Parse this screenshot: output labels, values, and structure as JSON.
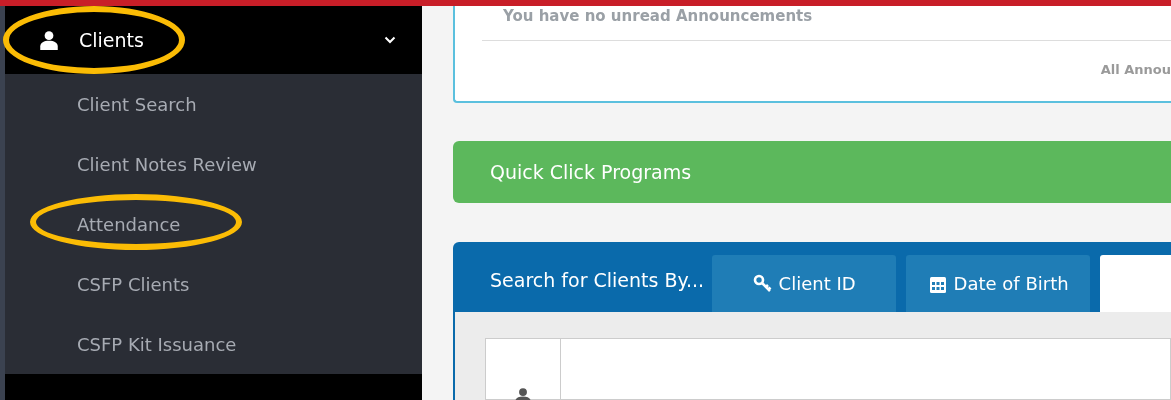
{
  "sidebar": {
    "section": {
      "label": "Clients",
      "expanded": true,
      "highlighted": true
    },
    "items": [
      {
        "label": "Client Search",
        "highlighted": false
      },
      {
        "label": "Client Notes Review",
        "highlighted": false
      },
      {
        "label": "Attendance",
        "highlighted": true
      },
      {
        "label": "CSFP Clients",
        "highlighted": false
      },
      {
        "label": "CSFP Kit Issuance",
        "highlighted": false
      }
    ]
  },
  "announcements": {
    "message": "You have no unread Announcements",
    "link": "All Annou"
  },
  "quick_click": {
    "title": "Quick Click Programs"
  },
  "client_search": {
    "title": "Search for Clients By...",
    "tabs": [
      {
        "label": "Client ID",
        "kind": "key",
        "selected": false
      },
      {
        "label": "Date of Birth",
        "kind": "calendar",
        "selected": false
      },
      {
        "kind": "none",
        "selected": true
      }
    ]
  }
}
